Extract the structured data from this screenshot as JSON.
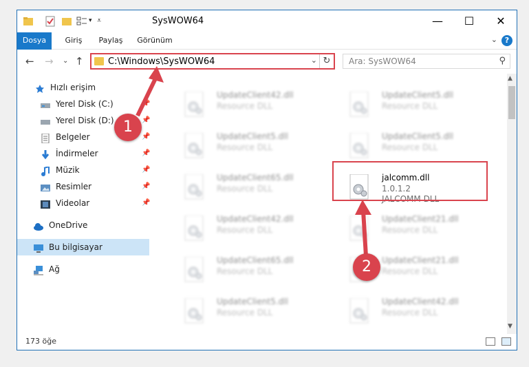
{
  "window": {
    "title": "SysWOW64",
    "minimize": "—",
    "maximize": "☐",
    "close": "✕"
  },
  "ribbon": {
    "tabs": [
      "Dosya",
      "Giriş",
      "Paylaş",
      "Görünüm"
    ],
    "help": "?"
  },
  "address": {
    "path": "C:\\Windows\\SysWOW64",
    "search_placeholder": "Ara: SysWOW64"
  },
  "sidebar": {
    "quick_access": "Hızlı erişim",
    "items": [
      "Yerel Disk (C:)",
      "Yerel Disk (D:)",
      "Belgeler",
      "İndirmeler",
      "Müzik",
      "Resimler",
      "Videolar"
    ],
    "onedrive": "OneDrive",
    "this_pc": "Bu bilgisayar",
    "network": "Ağ"
  },
  "files_left": [
    {
      "name": "UpdateClient42.dll",
      "desc": "Resource DLL"
    },
    {
      "name": "UpdateClient5.dll",
      "desc": "Resource DLL"
    },
    {
      "name": "UpdateClient65.dll",
      "desc": "Resource DLL"
    },
    {
      "name": "UpdateClient42.dll",
      "desc": "Resource DLL"
    },
    {
      "name": "UpdateClient65.dll",
      "desc": "Resource DLL"
    },
    {
      "name": "UpdateClient5.dll",
      "desc": "Resource DLL"
    }
  ],
  "files_right": [
    {
      "name": "UpdateClient5.dll",
      "desc": "Resource DLL"
    },
    {
      "name": "UpdateClient5.dll",
      "desc": "Resource DLL"
    },
    {
      "name": "UpdateClient21.dll",
      "desc": "Resource DLL"
    },
    {
      "name": "UpdateClient21.dll",
      "desc": "Resource DLL"
    },
    {
      "name": "UpdateClient42.dll",
      "desc": "Resource DLL"
    }
  ],
  "selected_file": {
    "name": "jalcomm.dll",
    "version": "1.0.1.2",
    "desc": "JALCOMM DLL"
  },
  "status": {
    "count": "173 öğe"
  },
  "annotations": {
    "step1": "1",
    "step2": "2",
    "color": "#d9434d"
  }
}
